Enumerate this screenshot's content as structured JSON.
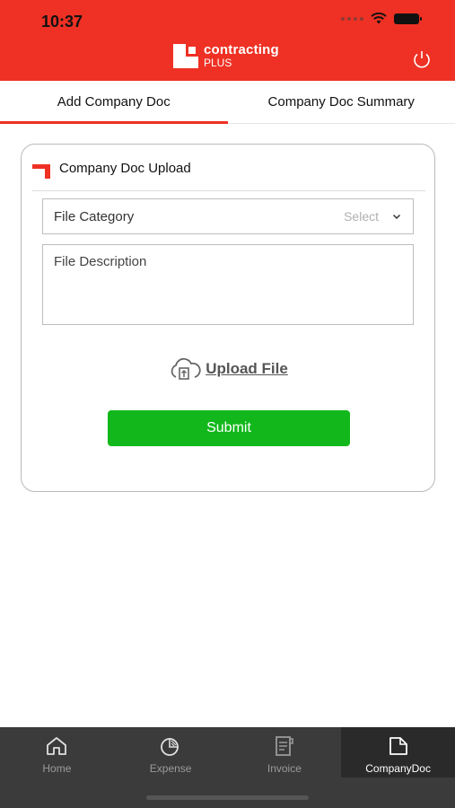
{
  "status_bar": {
    "time": "10:37"
  },
  "brand": {
    "line1": "contracting",
    "line2": "PLUS",
    "color": "#ee3124"
  },
  "tabs": [
    {
      "label": "Add Company Doc",
      "active": true
    },
    {
      "label": "Company Doc Summary",
      "active": false
    }
  ],
  "form": {
    "title": "Company Doc Upload",
    "file_category": {
      "label": "File Category",
      "value": "Select"
    },
    "file_description": {
      "placeholder": "File Description",
      "value": ""
    },
    "upload_label": "Upload File",
    "submit_label": "Submit",
    "submit_color": "#12b81b"
  },
  "bottom_nav": [
    {
      "label": "Home",
      "icon": "home-icon",
      "active": false
    },
    {
      "label": "Expense",
      "icon": "pie-chart-icon",
      "active": false
    },
    {
      "label": "Invoice",
      "icon": "invoice-icon",
      "active": false
    },
    {
      "label": "CompanyDoc",
      "icon": "document-icon",
      "active": true
    }
  ],
  "icons": {
    "power": "power-icon",
    "upload": "cloud-upload-icon",
    "dropdown": "chevron-down-icon"
  }
}
